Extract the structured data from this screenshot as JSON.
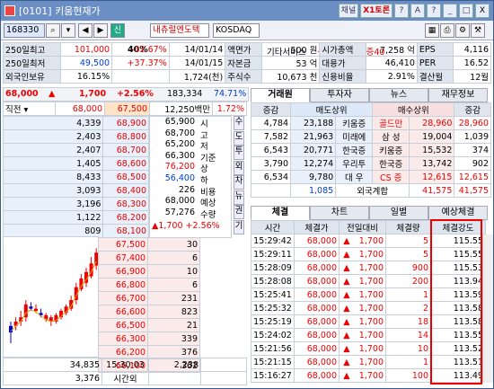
{
  "title": "[0101] 키움현재가",
  "title_buttons": [
    "채널",
    "X1토론",
    "?",
    "A",
    "?",
    "_",
    "□",
    "X"
  ],
  "search": {
    "code": "168330",
    "badge": "신",
    "margin": "40%",
    "name": "내츄럴엔도텍",
    "market": "KOSDAQ",
    "sector": "기타서비스",
    "credit": "신용C/담보C/증40"
  },
  "info": {
    "rows": [
      [
        "250일최고",
        "101,000",
        "-32.67%",
        "14/01/14",
        "액면가",
        "500 원",
        "시가총액",
        "7,258 억",
        "EPS",
        "4,116"
      ],
      [
        "250일최저",
        "49,500",
        "+37.37%",
        "14/01/15",
        "자본금",
        "53 억",
        "대용가",
        "46,410",
        "PER",
        "16.52"
      ],
      [
        "외국인보유",
        "16.15%",
        "",
        "1,724(천)",
        "주식수",
        "10,673 천",
        "신용비율",
        "2.91%",
        "결산월",
        "12월"
      ]
    ]
  },
  "price": {
    "current": "68,000",
    "arrow": "▲",
    "change": "1,700",
    "rate": "+2.56%",
    "volume": "183,334",
    "ratio": "74.71%"
  },
  "book": {
    "head": [
      "직전",
      "68,000",
      "67,500",
      "12,250백만",
      "1.72%"
    ],
    "asks": [
      [
        "4,339",
        "68,900"
      ],
      [
        "2,403",
        "68,800"
      ],
      [
        "2,407",
        "68,700"
      ],
      [
        "1,405",
        "68,600"
      ],
      [
        "8,433",
        "68,500"
      ],
      [
        "3,093",
        "68,400"
      ],
      [
        "3,196",
        "68,300"
      ],
      [
        "1,122",
        "68,200"
      ],
      [
        "809",
        "68,100"
      ],
      [
        "7,628",
        "68,000"
      ]
    ],
    "bids": [
      [
        "67,500",
        "30"
      ],
      [
        "67,400",
        "6"
      ],
      [
        "66,900",
        "10"
      ],
      [
        "66,800",
        "6"
      ],
      [
        "66,700",
        "231"
      ],
      [
        "66,600",
        "823"
      ],
      [
        "66,500",
        "21"
      ],
      [
        "66,300",
        "339"
      ],
      [
        "66,200",
        "376"
      ],
      [
        "66,100",
        "362"
      ]
    ],
    "stats": [
      [
        "65,900",
        "시"
      ],
      [
        "68,700",
        "고"
      ],
      [
        "65,200",
        "저"
      ],
      [
        "66,300",
        "기준"
      ],
      [
        "76,200",
        "상"
      ],
      [
        "56,400",
        "하"
      ],
      [
        "226",
        "비용"
      ],
      [
        "68,000",
        "예상"
      ],
      [
        "57,276",
        "수량"
      ]
    ],
    "est_change": "1,700",
    "est_rate": "+2.56%",
    "side_tabs": [
      "수",
      "도",
      "투",
      "외",
      "차",
      "뉴",
      "권",
      "기"
    ],
    "total_ask": "34,835",
    "total_time": "15:30:03",
    "total_bid": "2,238",
    "after_qty": "3,376",
    "after_label": "시간외"
  },
  "broker": {
    "tabs": [
      "거래원",
      "투자자",
      "뉴스",
      "재무정보"
    ],
    "header": [
      "증감",
      "매도상위",
      "매수상위",
      "증감"
    ],
    "rows": [
      [
        "4,784",
        "23,188",
        "키움증",
        "골드만",
        "28,960",
        "28,960"
      ],
      [
        "7,582",
        "21,963",
        "미래에",
        "삼  성",
        "19,004",
        "1,039"
      ],
      [
        "6,543",
        "20,771",
        "한국증",
        "키움증",
        "15,532",
        "374"
      ],
      [
        "3,790",
        "12,274",
        "우리투",
        "한국증",
        "13,742",
        "902"
      ],
      [
        "6,534",
        "9,780",
        "대  우",
        "CS  증",
        "12,615",
        "12,615"
      ]
    ],
    "foreign_sell": "1,085",
    "foreign_label": "외국계합",
    "foreign_buy": "41,575",
    "foreign_buy2": "41,575"
  },
  "ticks": {
    "tabs": [
      "체결",
      "차트",
      "일별",
      "예상체결"
    ],
    "header": [
      "시간",
      "체결가",
      "전일대비",
      "체결량",
      "체결강도"
    ],
    "rows": [
      [
        "15:29:42",
        "68,000",
        "▲",
        "1,700",
        "5",
        "115.55"
      ],
      [
        "15:29:11",
        "68,000",
        "▲",
        "1,700",
        "5",
        "115.55"
      ],
      [
        "15:28:09",
        "68,000",
        "▲",
        "1,700",
        "900",
        "115.53"
      ],
      [
        "15:28:08",
        "68,000",
        "▲",
        "1,700",
        "200",
        "113.94"
      ],
      [
        "15:25:41",
        "68,000",
        "▲",
        "1,700",
        "1",
        "113.59"
      ],
      [
        "15:25:32",
        "68,000",
        "▲",
        "1,700",
        "2",
        "113.58"
      ],
      [
        "15:25:19",
        "68,000",
        "▲",
        "1,700",
        "18",
        "113.58"
      ],
      [
        "15:24:02",
        "68,000",
        "▲",
        "1,700",
        "14",
        "113.55"
      ],
      [
        "15:21:56",
        "68,000",
        "▲",
        "1,700",
        "10",
        "113.52"
      ],
      [
        "15:21:15",
        "68,000",
        "▲",
        "1,700",
        "1",
        "113.51"
      ],
      [
        "15:16:27",
        "68,000",
        "▲",
        "1,700",
        "100",
        "113.49"
      ]
    ]
  },
  "colors": {
    "up": "#e00000",
    "down": "#0040d0",
    "title_bar": "#6b8ec4",
    "highlight": "#e00000"
  }
}
